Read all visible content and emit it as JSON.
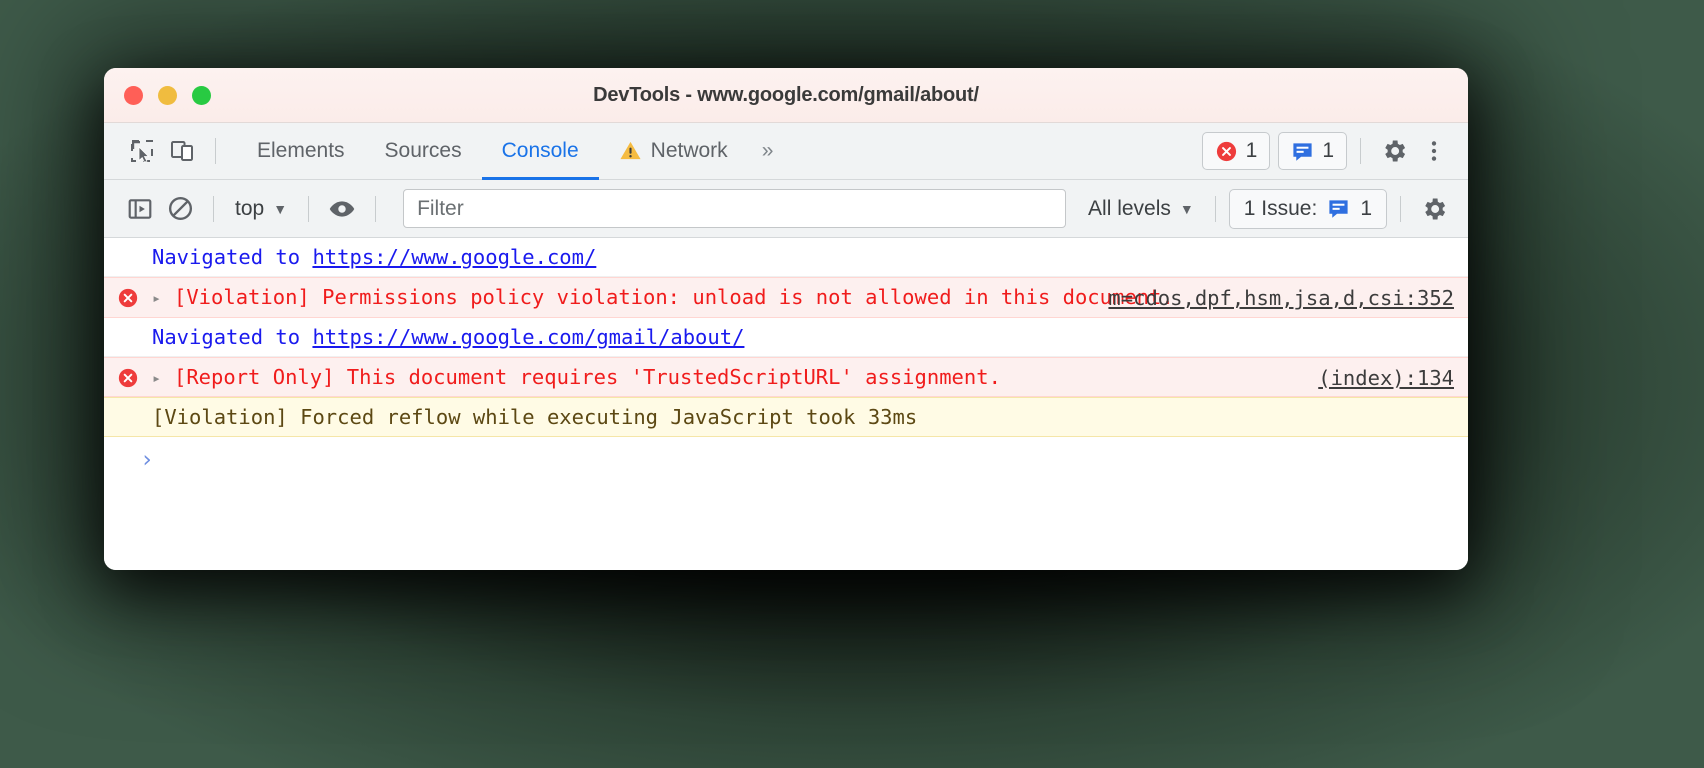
{
  "window": {
    "title": "DevTools - www.google.com/gmail/about/",
    "traffic_lights": [
      "close",
      "minimize",
      "maximize"
    ]
  },
  "toolbar": {
    "inspect_icon": "inspect-element-icon",
    "device_icon": "device-toolbar-icon",
    "tabs": [
      {
        "label": "Elements",
        "active": false,
        "warning": false
      },
      {
        "label": "Sources",
        "active": false,
        "warning": false
      },
      {
        "label": "Console",
        "active": true,
        "warning": false
      },
      {
        "label": "Network",
        "active": false,
        "warning": true
      }
    ],
    "more_tabs_label": "»",
    "error_badge": {
      "icon": "error-circle-icon",
      "count": "1"
    },
    "message_badge": {
      "icon": "message-icon",
      "count": "1"
    },
    "settings_icon": "gear-icon",
    "more_options_icon": "kebab-menu-icon"
  },
  "console_toolbar": {
    "sidebar_toggle_icon": "console-sidebar-icon",
    "clear_icon": "clear-console-icon",
    "context_label": "top",
    "context_caret": "▼",
    "eye_icon": "live-expression-icon",
    "filter": {
      "placeholder": "Filter",
      "value": ""
    },
    "levels_label": "All levels",
    "levels_caret": "▼",
    "issues": {
      "label": "1 Issue:",
      "icon": "message-icon",
      "count": "1"
    },
    "settings_icon": "gear-icon"
  },
  "console_messages": [
    {
      "type": "info",
      "has_icon": false,
      "has_arrow": false,
      "prefix": "Navigated to ",
      "link": "https://www.google.com/",
      "source": ""
    },
    {
      "type": "error",
      "has_icon": true,
      "has_arrow": true,
      "text": "[Violation] Permissions policy violation: unload is not allowed in this document.",
      "source": "m=cdos,dpf,hsm,jsa,d,csi:352"
    },
    {
      "type": "info",
      "has_icon": false,
      "has_arrow": false,
      "prefix": "Navigated to ",
      "link": "https://www.google.com/gmail/about/",
      "source": ""
    },
    {
      "type": "error",
      "has_icon": true,
      "has_arrow": true,
      "text": "[Report Only] This document requires 'TrustedScriptURL' assignment.",
      "source": "(index):134"
    },
    {
      "type": "warn",
      "has_icon": false,
      "has_arrow": false,
      "text": "[Violation] Forced reflow while executing JavaScript took 33ms",
      "source": ""
    }
  ],
  "prompt": {
    "caret": "›",
    "value": ""
  },
  "colors": {
    "accent_blue": "#1a73e8",
    "error_red": "#f01c1c",
    "error_bg": "#fdf0ef",
    "warn_bg": "#fffbe5",
    "warn_text": "#5c4813",
    "link_blue": "#1a1aee",
    "toolbar_bg": "#f1f3f4",
    "titlebar_bg": "#fbece9"
  }
}
